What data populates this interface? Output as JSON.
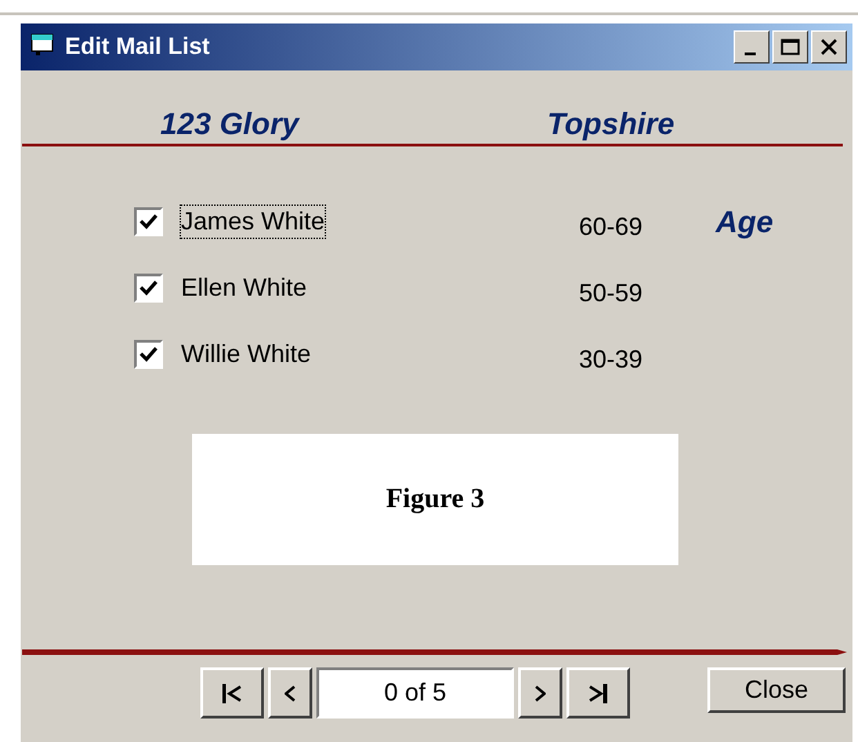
{
  "window": {
    "title": "Edit Mail List"
  },
  "header": {
    "address": "123 Glory",
    "city": "Topshire"
  },
  "members": [
    {
      "name": "James White",
      "checked": true,
      "focused": true,
      "age_range": "60-69"
    },
    {
      "name": "Ellen White",
      "checked": true,
      "focused": false,
      "age_range": "50-59"
    },
    {
      "name": "Willie White",
      "checked": true,
      "focused": false,
      "age_range": "30-39"
    }
  ],
  "age_label": "Age",
  "figure": {
    "caption": "Figure 3"
  },
  "navigator": {
    "position": "0 of 5"
  },
  "buttons": [
    {
      "label": "Close"
    }
  ]
}
